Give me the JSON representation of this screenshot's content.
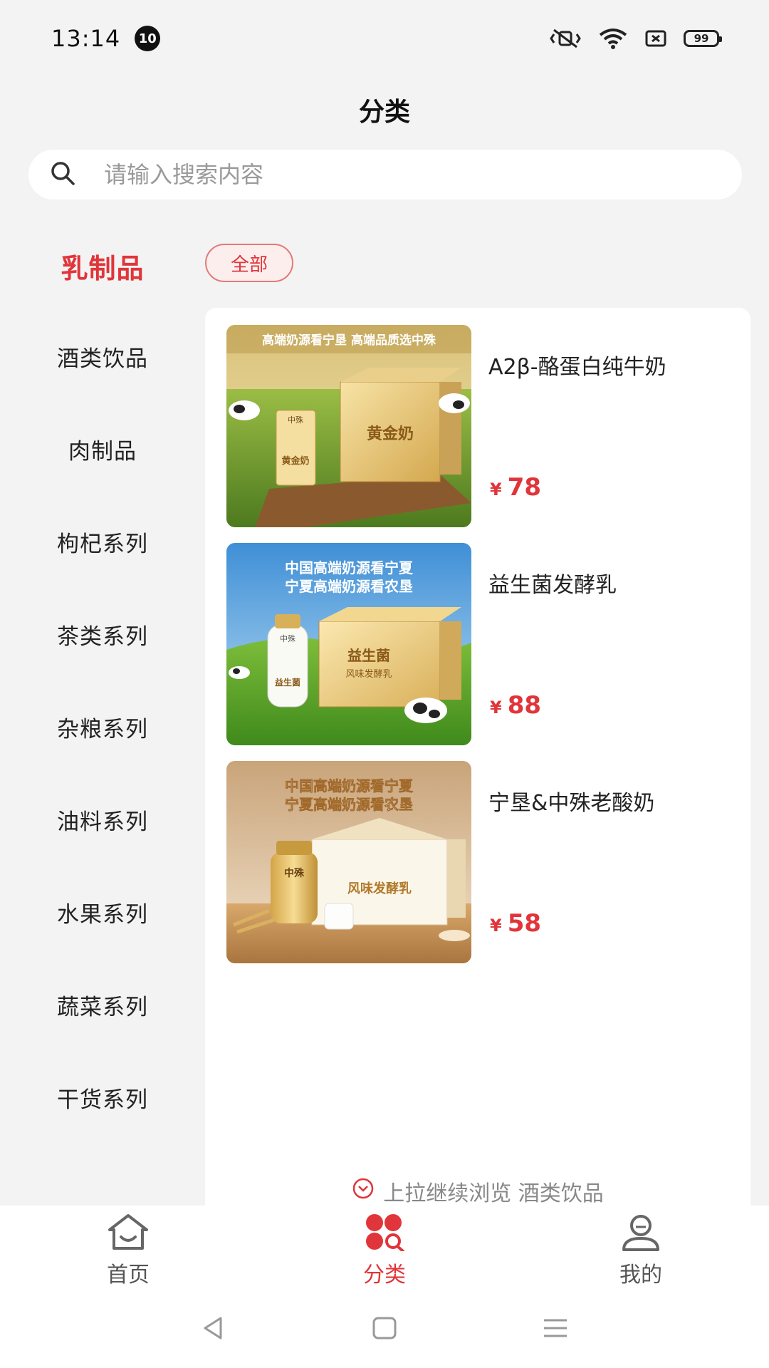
{
  "status_bar": {
    "time": "13:14",
    "notification_count": "10",
    "battery": "99"
  },
  "header": {
    "title": "分类"
  },
  "search": {
    "placeholder": "请输入搜索内容"
  },
  "sidebar": {
    "items": [
      {
        "label": "乳制品",
        "active": true
      },
      {
        "label": "酒类饮品",
        "active": false
      },
      {
        "label": "肉制品",
        "active": false
      },
      {
        "label": "枸杞系列",
        "active": false
      },
      {
        "label": "茶类系列",
        "active": false
      },
      {
        "label": "杂粮系列",
        "active": false
      },
      {
        "label": "油料系列",
        "active": false
      },
      {
        "label": "水果系列",
        "active": false
      },
      {
        "label": "蔬菜系列",
        "active": false
      },
      {
        "label": "干货系列",
        "active": false
      }
    ]
  },
  "filter": {
    "chip_label": "全部"
  },
  "products": [
    {
      "name": "A2β-酪蛋白纯牛奶",
      "currency": "¥",
      "price": "78",
      "image": {
        "banner": "高端奶源看宁垦 高端品质选中殊",
        "box_text": "黄金奶",
        "bottle_text": "黄金奶",
        "bottle_top": "中殊"
      }
    },
    {
      "name": "益生菌发酵乳",
      "currency": "¥",
      "price": "88",
      "image": {
        "banner_line1": "中国高端奶源看宁夏",
        "banner_line2": "宁夏高端奶源看农垦",
        "box_text": "益生菌",
        "box_subtext": "风味发酵乳",
        "bottle_text": "益生菌",
        "bottle_top": "中殊"
      }
    },
    {
      "name": "宁垦&中殊老酸奶",
      "currency": "¥",
      "price": "58",
      "image": {
        "banner_line1": "中国高端奶源看宁夏",
        "banner_line2": "宁夏高端奶源看农垦",
        "box_text": "风味发酵乳",
        "jar_text": "中殊"
      }
    }
  ],
  "pull_hint": "上拉继续浏览 酒类饮品",
  "tabbar": {
    "items": [
      {
        "label": "首页",
        "icon": "home-icon",
        "active": false
      },
      {
        "label": "分类",
        "icon": "category-icon",
        "active": true
      },
      {
        "label": "我的",
        "icon": "profile-icon",
        "active": false
      }
    ]
  },
  "colors": {
    "accent": "#e0353a",
    "background": "#f3f3f3",
    "panel": "#ffffff"
  }
}
